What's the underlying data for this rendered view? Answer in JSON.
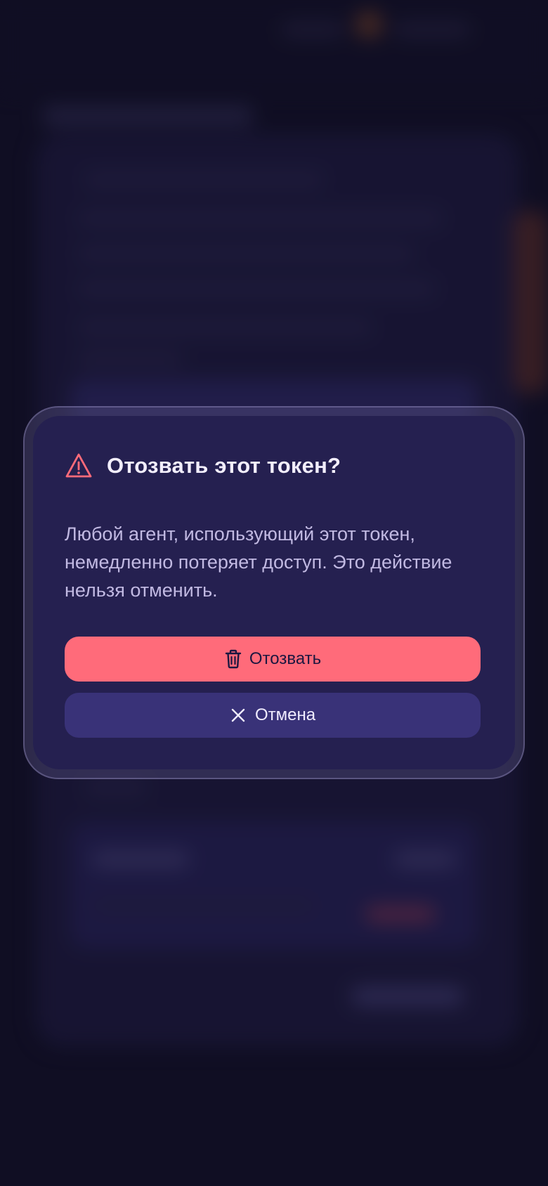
{
  "dialog": {
    "title": "Отозвать этот токен?",
    "message": "Любой агент, использующий этот токен, немедленно потеряет доступ. Это действие нельзя отменить.",
    "confirm_label": "Отозвать",
    "cancel_label": "Отмена",
    "warning_icon": "warning-triangle-icon",
    "confirm_icon": "trash-icon",
    "cancel_icon": "close-icon"
  },
  "colors": {
    "danger": "#ff6b7a",
    "dialog_bg": "#252050",
    "secondary_button": "#393278",
    "text_primary": "#f2eefc",
    "text_secondary": "#c1b9e2"
  }
}
